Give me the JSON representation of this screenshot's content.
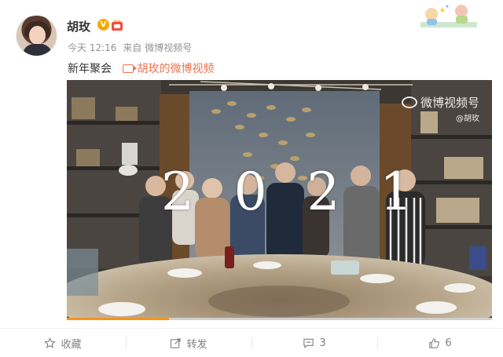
{
  "post": {
    "author": "胡玫",
    "verified_mark": "V",
    "time": "今天 12:16",
    "source_prefix": "来自",
    "source": "微博视频号",
    "text": "新年聚会",
    "video_link": "胡玫的微博视频"
  },
  "video": {
    "overlay_text": [
      "2",
      "0",
      "2",
      "1"
    ],
    "watermark": "微博视频号",
    "watermark_sub": "@胡玫",
    "progress_fraction": 0.24
  },
  "actions": [
    {
      "label": "收藏",
      "icon": "star-icon"
    },
    {
      "label": "转发",
      "icon": "share-icon"
    },
    {
      "label": "3",
      "icon": "comment-icon"
    },
    {
      "label": "6",
      "icon": "like-icon"
    }
  ],
  "colors": {
    "link": "#eb7350",
    "verified": "#f7a700",
    "progress": "#f7941d",
    "muted": "#939393"
  }
}
